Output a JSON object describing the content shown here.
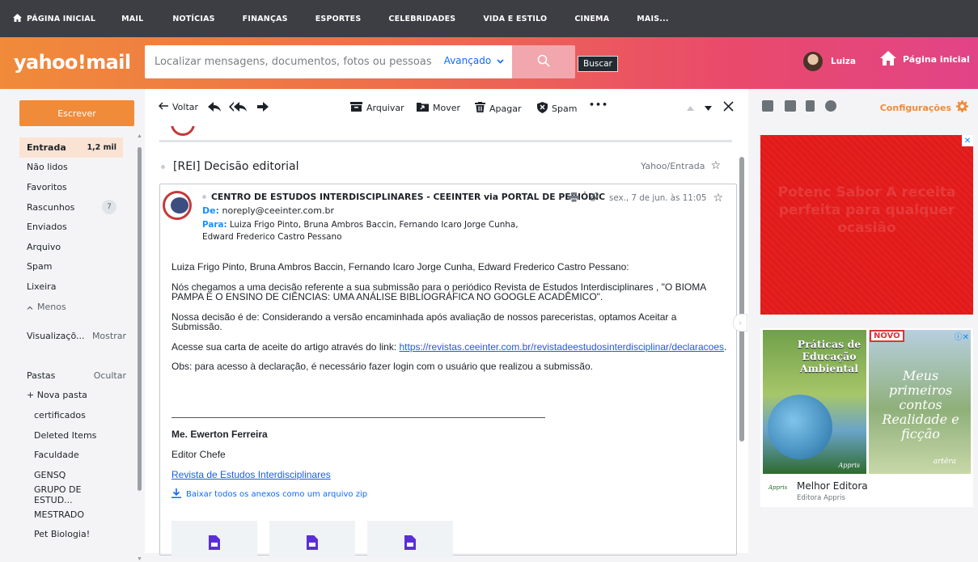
{
  "topnav": {
    "items": [
      "PÁGINA INICIAL",
      "MAIL",
      "NOTÍCIAS",
      "FINANÇAS",
      "ESPORTES",
      "CELEBRIDADES",
      "VIDA E ESTILO",
      "CINEMA",
      "MAIS..."
    ]
  },
  "header": {
    "logo": "yahoo!mail",
    "search_placeholder": "Localizar mensagens, documentos, fotos ou pessoas",
    "advanced_label": "Avançado",
    "search_tooltip": "Buscar",
    "user_name": "Luiza",
    "home_label": "Página inicial"
  },
  "sidebar": {
    "compose_label": "Escrever",
    "folders": [
      {
        "label": "Entrada",
        "count": "1,2 mil"
      },
      {
        "label": "Não lidos"
      },
      {
        "label": "Favoritos"
      },
      {
        "label": "Rascunhos",
        "count": "7"
      },
      {
        "label": "Enviados"
      },
      {
        "label": "Arquivo"
      },
      {
        "label": "Spam"
      },
      {
        "label": "Lixeira"
      },
      {
        "label": "Menos"
      }
    ],
    "views_label": "Visualizaçõ...",
    "views_action": "Mostrar",
    "folders_label": "Pastas",
    "folders_action": "Ocultar",
    "new_folder": "+ Nova pasta",
    "custom_folders": [
      "certificados",
      "Deleted Items",
      "Faculdade",
      "GENSQ",
      "GRUPO DE ESTUD...",
      "MESTRADO",
      "Pet Biologia!"
    ]
  },
  "toolbar": {
    "back": "Voltar",
    "archive": "Arquivar",
    "move": "Mover",
    "delete": "Apagar",
    "spam": "Spam",
    "more": "•••"
  },
  "thread": {
    "subject": "[REI] Decisão editorial",
    "folder": "Yahoo/Entrada"
  },
  "message": {
    "sender": "CENTRO DE ESTUDOS INTERDISCIPLINARES - CEEINTER via PORTAL DE PERIÓDIC",
    "from_label": "De:",
    "from": "noreply@ceeinter.com.br",
    "to_label": "Para:",
    "to_line1": "Luiza Frigo Pinto,  Bruna Ambros Baccin,  Fernando Icaro Jorge Cunha,",
    "to_line2": "Edward Frederico Castro Pessano",
    "date": "sex., 7 de jun. às 11:05",
    "body": {
      "greeting": "Luiza Frigo Pinto, Bruna Ambros Baccin, Fernando Icaro Jorge Cunha, Edward Frederico Castro Pessano:",
      "p1_line1": "Nós chegamos a uma decisão referente a sua submissão para o periódico Revista de Estudos Interdisciplinares , \"O BIOMA",
      "p1_line2": "PAMPA E O ENSINO DE CIÊNCIAS: UMA ANÁLISE BIBLIOGRÁFICA NO GOOGLE ACADÊMICO\".",
      "p2": "Nossa decisão é de: Considerando a versão encaminhada após avaliação de nossos pareceristas, optamos Aceitar a Submissão.",
      "p3_prefix": "Acesse sua carta de aceite do artigo através do link: ",
      "p3_link": "https://revistas.ceeinter.com.br/revistadeestudosinterdisciplinar/declaracoes",
      "p3_suffix": ".",
      "p4": "Obs: para acesso à declaração, é necessário fazer login com o usuário que realizou a submissão."
    },
    "signature": {
      "name": "Me. Ewerton Ferreira",
      "role": "Editor Chefe",
      "journal": "Revista de Estudos Interdisciplinares"
    },
    "download_all": "Baixar todos os anexos como um arquivo zip"
  },
  "right_pane": {
    "settings_label": "Configurações",
    "ad1_text": "Potenc Sabor A receita perfeita para qualquer ocasião",
    "ad2": {
      "book1_title": "Práticas de Educação Ambiental",
      "book1_publisher": "Appris",
      "novo_badge": "NOVO",
      "book2_script": "Meus primeiros contos Realidade e ficção",
      "book2_publisher": "artēra",
      "brand": "Melhor Editora",
      "brand_sub": "Editora Appris",
      "brand_logo": "Appris"
    }
  },
  "colors": {
    "accent_orange": "#f08b3a",
    "link_blue": "#0f69ff",
    "topnav_bg": "#3d3d44"
  }
}
